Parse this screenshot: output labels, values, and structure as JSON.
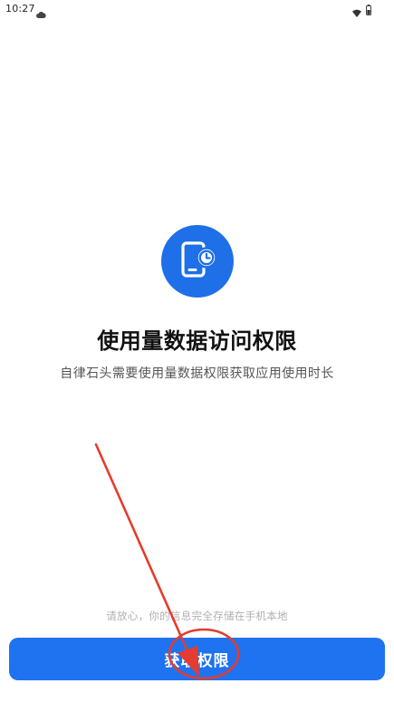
{
  "status_bar": {
    "time": "10:27"
  },
  "icons": {
    "status_cloud": "cloud-icon",
    "wifi": "wifi-icon",
    "battery": "battery-icon",
    "hero": "phone-clock-icon"
  },
  "permission": {
    "title": "使用量数据访问权限",
    "subtitle": "自律石头需要使用量数据权限获取应用使用时长",
    "note": "请放心，你的信息完全存储在手机本地",
    "button_label": "获取权限"
  },
  "colors": {
    "accent": "#1f73f0",
    "hero_circle": "#1e6fe8",
    "annotation_red": "#e43c2f"
  }
}
